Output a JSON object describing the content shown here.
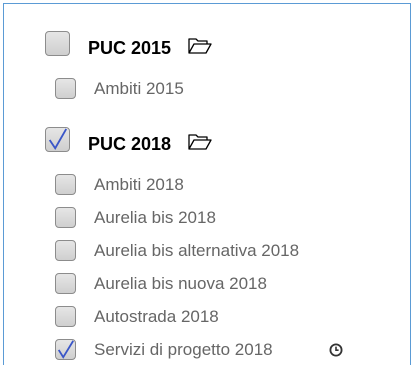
{
  "groups": [
    {
      "label": "PUC 2015",
      "checked": false,
      "icon": "folder-icon",
      "layers": [
        {
          "label": "Ambiti 2015",
          "checked": false
        }
      ]
    },
    {
      "label": "PUC 2018",
      "checked": true,
      "icon": "folder-icon",
      "layers": [
        {
          "label": "Ambiti 2018",
          "checked": false
        },
        {
          "label": "Aurelia bis 2018",
          "checked": false
        },
        {
          "label": "Aurelia bis alternativa 2018",
          "checked": false
        },
        {
          "label": "Aurelia bis nuova 2018",
          "checked": false
        },
        {
          "label": "Autostrada 2018",
          "checked": false
        },
        {
          "label": "Servizi di progetto 2018",
          "checked": true,
          "icon": "clock-icon"
        }
      ]
    }
  ],
  "colors": {
    "check": "#3a56c8",
    "panel_border": "#5b9bd5",
    "text": "#666666"
  }
}
